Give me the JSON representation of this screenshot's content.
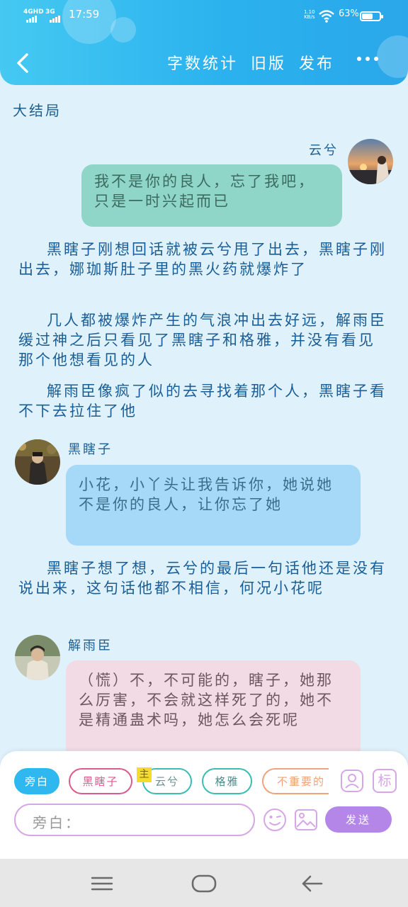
{
  "status_bar": {
    "network1": "4GHD",
    "network2": "3G",
    "time": "17:59",
    "speed_value": "1.10",
    "speed_unit": "KB/s",
    "battery": "63%",
    "battery_level": 0.63
  },
  "header": {
    "actions": [
      "字数统计",
      "旧版",
      "发布"
    ]
  },
  "chapter_title": "大结局",
  "messages": [
    {
      "speaker": "云兮",
      "text": "我不是你的良人，忘了我吧，只是一时兴起而已"
    },
    {
      "speaker": "黑瞎子",
      "text": "小花，小丫头让我告诉你，她说她不是你的良人，让你忘了她"
    },
    {
      "speaker": "解雨臣",
      "text": "（慌）不，不可能的，瞎子，她那么厉害，不会就这样死了的，她不是精通蛊术吗，她怎么会死呢"
    }
  ],
  "narrations": [
    "黑瞎子刚想回话就被云兮甩了出去，黑瞎子刚出去，娜珈斯肚子里的黑火药就爆炸了",
    "几人都被爆炸产生的气浪冲出去好远，解雨臣缓过神之后只看见了黑瞎子和格雅，并没有看见那个他想看见的人",
    "解雨臣像疯了似的去寻找着那个人，黑瞎子看不下去拉住了他",
    "黑瞎子想了想，云兮的最后一句话他还是没有说出来，这句话他都不相信，何况小花呢"
  ],
  "composer": {
    "roles": [
      "旁白",
      "黑瞎子",
      "云兮",
      "格雅",
      "不重要的"
    ],
    "main_tag": "主",
    "tag_icon_label": "标",
    "input_placeholder": "旁白：",
    "send_label": "发送"
  },
  "icons": {
    "back": "chevron-left-icon",
    "more": "more-dots-icon",
    "person": "person-icon",
    "tag": "tag-icon",
    "emoji": "emoji-icon",
    "image": "image-icon",
    "menu": "menu-icon",
    "home": "home-icon",
    "nav_back": "back-arrow-icon"
  },
  "colors": {
    "header": "#2bb2ee",
    "background": "#dff1fb",
    "bubble_yunxi": "#8fd6c8",
    "bubble_heixiazi": "#a6d8f7",
    "bubble_xieyuchen": "#f2dbe4",
    "send_button": "#b486e8"
  }
}
